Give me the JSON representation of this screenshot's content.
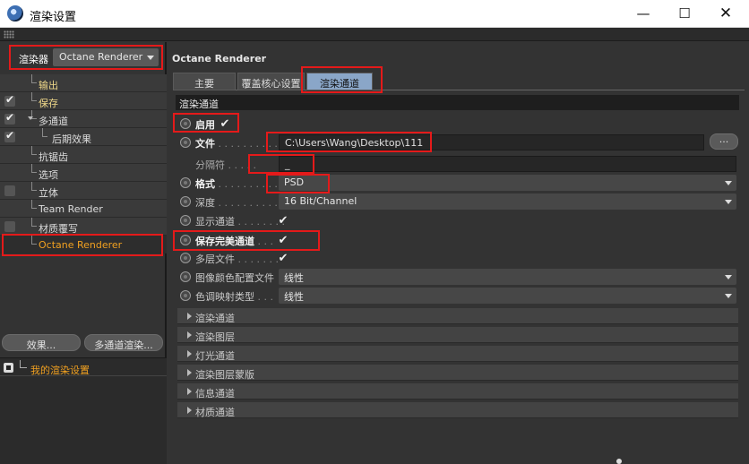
{
  "window": {
    "title": "渲染设置",
    "minimize": "—",
    "maximize": "☐",
    "close": "✕"
  },
  "left": {
    "renderer_label": "渲染器",
    "renderer_value": "Octane Renderer",
    "tree": [
      {
        "label": "输出",
        "checkbox": false,
        "checked": false,
        "indent": 1,
        "style": "yellow"
      },
      {
        "label": "保存",
        "checkbox": true,
        "checked": true,
        "indent": 1,
        "style": "yellow"
      },
      {
        "label": "多通道",
        "checkbox": true,
        "checked": true,
        "indent": 1,
        "style": "normal",
        "expander": true
      },
      {
        "label": "后期效果",
        "checkbox": true,
        "checked": true,
        "indent": 2,
        "style": "normal"
      },
      {
        "label": "抗锯齿",
        "checkbox": false,
        "checked": false,
        "indent": 1,
        "style": "normal"
      },
      {
        "label": "选项",
        "checkbox": false,
        "checked": false,
        "indent": 1,
        "style": "normal"
      },
      {
        "label": "立体",
        "checkbox": true,
        "checked": false,
        "indent": 1,
        "style": "normal"
      },
      {
        "label": "Team Render",
        "checkbox": false,
        "checked": false,
        "indent": 1,
        "style": "normal"
      },
      {
        "label": "材质覆写",
        "checkbox": true,
        "checked": false,
        "indent": 1,
        "style": "normal"
      },
      {
        "label": "Octane Renderer",
        "checkbox": false,
        "checked": false,
        "indent": 1,
        "style": "orange"
      }
    ],
    "effects_button": "效果...",
    "multipass_button": "多通道渲染...",
    "preset": "我的渲染设置"
  },
  "right": {
    "title": "Octane Renderer",
    "tabs": [
      "主要",
      "覆盖核心设置",
      "渲染通道"
    ],
    "active_tab": 2,
    "section_header": "渲染通道",
    "enable_label": "启用",
    "enable_checked": "✔",
    "file_label": "文件",
    "file_value": "C:\\Users\\Wang\\Desktop\\111",
    "browse_label": "...",
    "separator_label": "分隔符",
    "separator_value": "_",
    "format_label": "格式",
    "format_value": "PSD",
    "depth_label": "深度",
    "depth_value": "16 Bit/Channel",
    "show_passes_label": "显示通道",
    "show_passes_checked": "✔",
    "save_beauty_label": "保存完美通道",
    "save_beauty_checked": "✔",
    "multilayer_label": "多层文件",
    "multilayer_checked": "✔",
    "color_profile_label": "图像颜色配置文件",
    "color_profile_value": "线性",
    "tonemap_label": "色调映射类型",
    "tonemap_value": "线性",
    "groups": [
      "渲染通道",
      "渲染图层",
      "灯光通道",
      "渲染图层蒙版",
      "信息通道",
      "材质通道"
    ]
  },
  "colors": {
    "highlight_box": "#e41a1a",
    "active_tab": "#8aa6c8",
    "orange_text": "#f0a020",
    "yellow_text": "#f0d98a"
  }
}
